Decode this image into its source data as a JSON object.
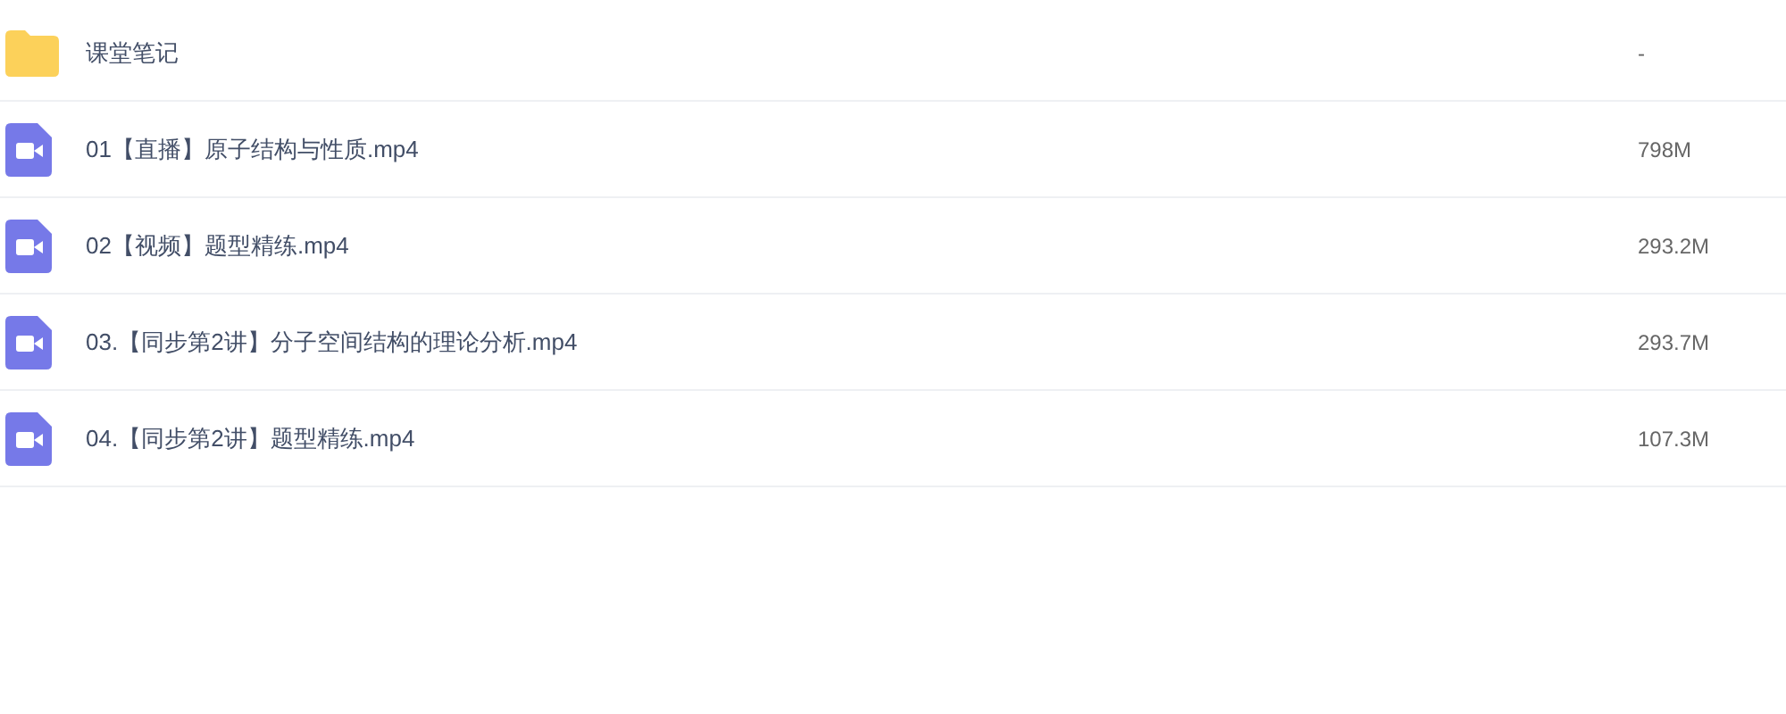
{
  "files": [
    {
      "kind": "folder",
      "name": "课堂笔记",
      "size": "-"
    },
    {
      "kind": "video",
      "name": "01【直播】原子结构与性质.mp4",
      "size": "798M"
    },
    {
      "kind": "video",
      "name": "02【视频】题型精练.mp4",
      "size": "293.2M"
    },
    {
      "kind": "video",
      "name": "03.【同步第2讲】分子空间结构的理论分析.mp4",
      "size": "293.7M"
    },
    {
      "kind": "video",
      "name": "04.【同步第2讲】题型精练.mp4",
      "size": "107.3M"
    }
  ]
}
